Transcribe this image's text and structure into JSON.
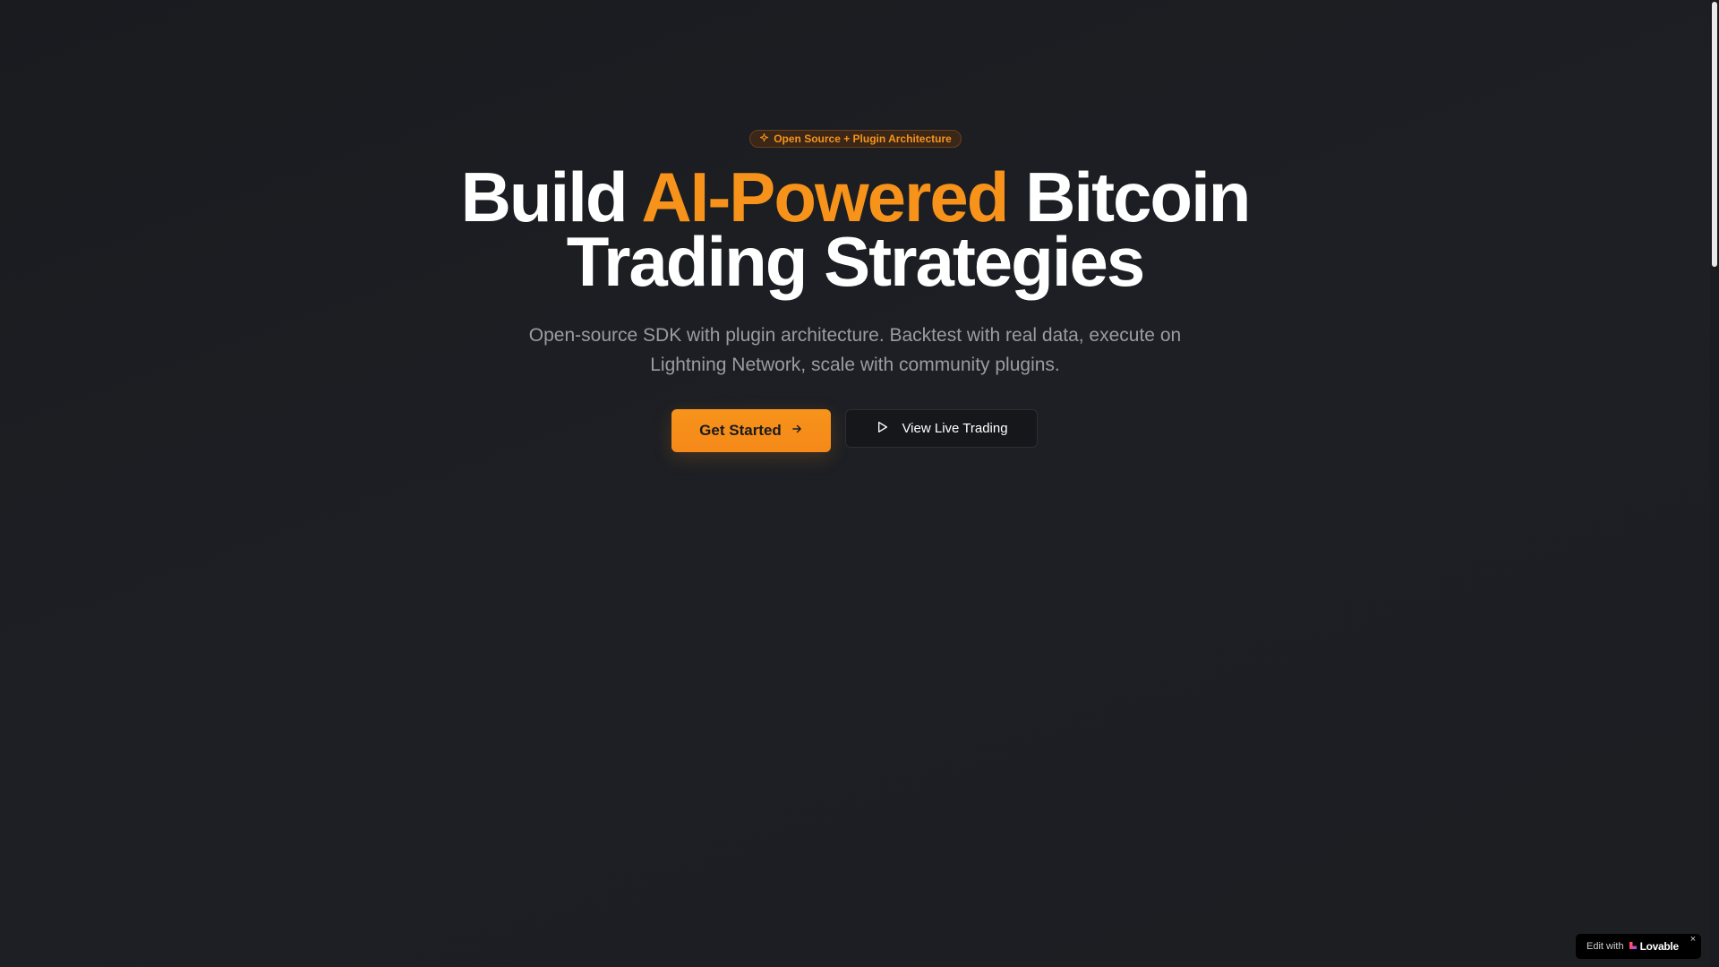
{
  "badge": {
    "icon": "sparkle-icon",
    "label": "Open Source + Plugin Architecture"
  },
  "headline": {
    "part1": "Build ",
    "accent": "AI-Powered",
    "part2": " Bitcoin",
    "line2": "Trading Strategies"
  },
  "subtitle": "Open-source SDK with plugin architecture. Backtest with real data, execute on Lightning Network, scale with community plugins.",
  "buttons": {
    "primary": {
      "label": "Get Started",
      "icon": "arrow-right-icon"
    },
    "secondary": {
      "label": "View Live Trading",
      "icon": "play-icon"
    }
  },
  "lovable": {
    "edit_with": "Edit with",
    "brand": "Lovable",
    "close": "×"
  },
  "colors": {
    "accent": "#f7931a",
    "background": "#1c1e22",
    "text_muted": "#9a9ca3"
  }
}
